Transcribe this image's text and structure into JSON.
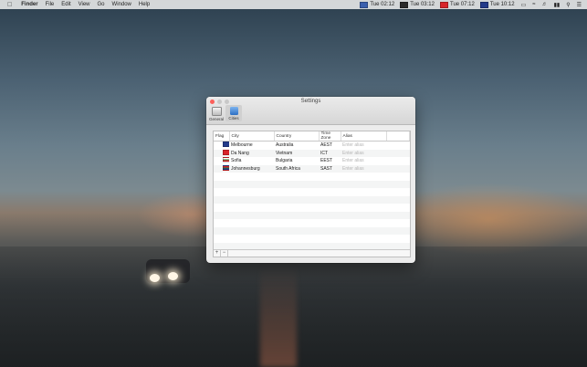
{
  "menubar": {
    "app_name": "Finder",
    "items": [
      "File",
      "Edit",
      "View",
      "Go",
      "Window",
      "Help"
    ],
    "clocks": [
      {
        "time": "Tue 02:12",
        "flag_color": "#3a5fae"
      },
      {
        "time": "Tue 03:12",
        "flag_color": "#2a2a2a"
      },
      {
        "time": "Tue 07:12",
        "flag_color": "#d8242a"
      },
      {
        "time": "Tue 10:12",
        "flag_color": "#233a8a"
      }
    ]
  },
  "window": {
    "title": "Settings",
    "tabs": [
      {
        "label": "General",
        "icon": "phone-icon"
      },
      {
        "label": "Cities",
        "icon": "globe-icon"
      }
    ],
    "table": {
      "headers": [
        "Flag",
        "City",
        "Country",
        "Time Zone",
        "Alias"
      ],
      "rows": [
        {
          "flag_color": "#233a8a",
          "city": "Melbourne",
          "country": "Australia",
          "tz": "AEST",
          "alias_placeholder": "Enter alias"
        },
        {
          "flag_color": "#d8242a",
          "city": "Da Nang",
          "country": "Vietnam",
          "tz": "ICT",
          "alias_placeholder": "Enter alias"
        },
        {
          "flag_color": "#2e8a3e",
          "city": "Sofia",
          "country": "Bulgaria",
          "tz": "EEST",
          "alias_placeholder": "Enter alias"
        },
        {
          "flag_color": "#1e7a3a",
          "city": "Johannesburg",
          "country": "South Africa",
          "tz": "SAST",
          "alias_placeholder": "Enter alias"
        }
      ]
    },
    "buttons": {
      "add": "+",
      "remove": "−"
    }
  },
  "colors": {
    "close": "#fc605b",
    "minimize": "#c8c8c8",
    "zoom": "#c8c8c8",
    "accent": "#3a7bd5"
  }
}
